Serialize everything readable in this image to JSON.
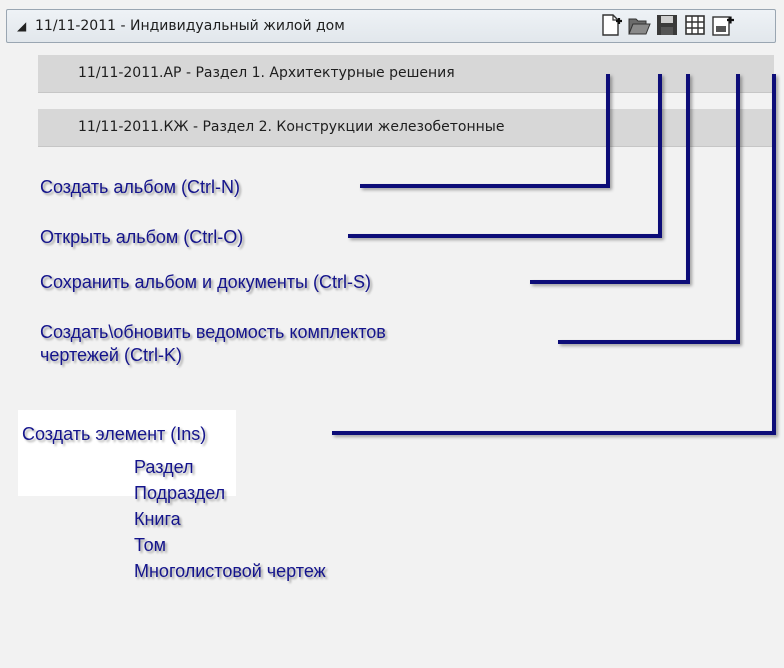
{
  "header": {
    "title": "11/11-2011 - Индивидуальный жилой дом",
    "expand_glyph": "◢"
  },
  "toolbar": [
    {
      "icon": "new-document-icon"
    },
    {
      "icon": "open-folder-icon"
    },
    {
      "icon": "save-icon"
    },
    {
      "icon": "table-grid-icon"
    },
    {
      "icon": "insert-element-icon"
    }
  ],
  "rows": [
    {
      "label": "11/11-2011.АР - Раздел 1. Архитектурные решения"
    },
    {
      "label": "11/11-2011.КЖ - Раздел 2. Конструкции железобетонные"
    }
  ],
  "callouts": {
    "create_album": "Создать альбом (Ctrl-N)",
    "open_album": "Открыть альбом (Ctrl-O)",
    "save_album": "Сохранить альбом и документы (Ctrl-S)",
    "update_statement_line1": "Создать\\обновить ведомость комплектов",
    "update_statement_line2": "чертежей (Ctrl-K)",
    "create_element": "Создать элемент (Ins)"
  },
  "element_types": [
    "Раздел",
    "Подраздел",
    "Книга",
    "Том",
    "Многолистовой чертеж"
  ],
  "colors": {
    "callout_text": "#14148c",
    "leader_line": "#0a0a78",
    "row_background": "#d7d7d7"
  }
}
